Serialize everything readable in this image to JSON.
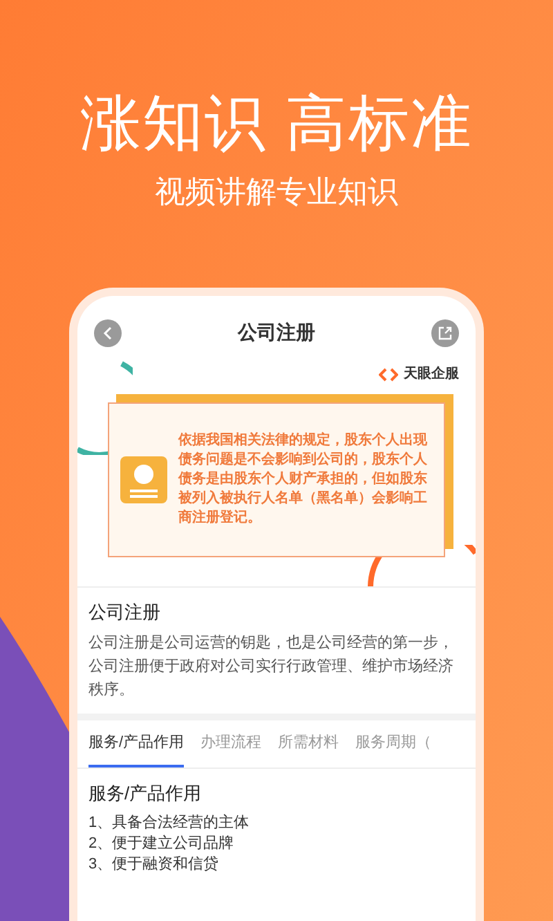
{
  "headline": "涨知识 高标准",
  "subtitle": "视频讲解专业知识",
  "screen": {
    "title": "公司注册",
    "brand": "天眼企服",
    "notice": "依据我国相关法律的规定，股东个人出现债务问题是不会影响到公司的，股东个人债务是由股东个人财产承担的，但如股东被列入被执行人名单（黑名单）会影响工商注册登记。",
    "intro": {
      "title": "公司注册",
      "text": "公司注册是公司运营的钥匙，也是公司经营的第一步，公司注册便于政府对公司实行行政管理、维护市场经济秩序。"
    },
    "tabs": [
      {
        "label": "服务/产品作用",
        "selected": true
      },
      {
        "label": "办理流程",
        "selected": false
      },
      {
        "label": "所需材料",
        "selected": false
      },
      {
        "label": "服务周期（",
        "selected": false
      }
    ],
    "content": {
      "title": "服务/产品作用",
      "items": [
        "1、具备合法经营的主体",
        "2、便于建立公司品牌",
        "3、便于融资和信贷"
      ]
    }
  }
}
